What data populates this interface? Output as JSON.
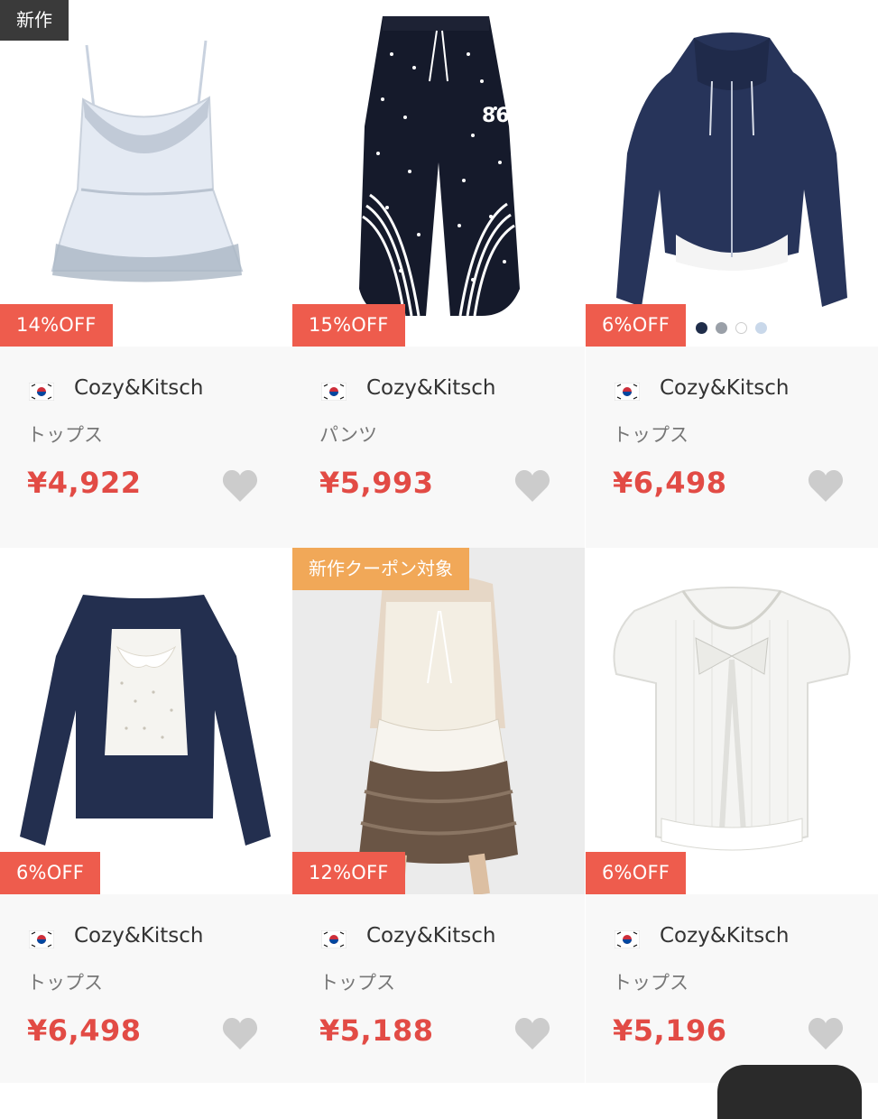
{
  "colors": {
    "discount_badge": "#ee5c4d",
    "price": "#e24b45",
    "new_badge": "#3a3a3a",
    "coupon_badge": "#f1a858",
    "heart": "#cccccc",
    "info_bg": "#f8f8f8"
  },
  "products": [
    {
      "top_badge": "新作",
      "discount": "14%OFF",
      "flag_icon": "korea-flag-icon",
      "brand": "Cozy&Kitsch",
      "category": "トップス",
      "price": "¥4,922",
      "image": "lace-camisole-top"
    },
    {
      "top_badge": "",
      "discount": "15%OFF",
      "flag_icon": "korea-flag-icon",
      "brand": "Cozy&Kitsch",
      "category": "パンツ",
      "price": "¥5,993",
      "image": "star-print-track-pants"
    },
    {
      "top_badge": "",
      "discount": "6%OFF",
      "flag_icon": "korea-flag-icon",
      "brand": "Cozy&Kitsch",
      "category": "トップス",
      "price": "¥6,498",
      "image": "navy-zip-hoodie",
      "color_dots": [
        "#1f2d4a",
        "#9aa0a8",
        "#ffffff",
        "#c9d8ea"
      ]
    },
    {
      "top_badge": "",
      "discount": "6%OFF",
      "flag_icon": "korea-flag-icon",
      "brand": "Cozy&Kitsch",
      "category": "トップス",
      "price": "¥6,498",
      "image": "navy-cardigan-set"
    },
    {
      "top_badge": "新作クーポン対象",
      "discount": "12%OFF",
      "flag_icon": "korea-flag-icon",
      "brand": "Cozy&Kitsch",
      "category": "トップス",
      "price": "¥5,188",
      "image": "ruffle-camisole-model"
    },
    {
      "top_badge": "",
      "discount": "6%OFF",
      "flag_icon": "korea-flag-icon",
      "brand": "Cozy&Kitsch",
      "category": "トップス",
      "price": "¥5,196",
      "image": "white-ribbon-blouse"
    }
  ]
}
